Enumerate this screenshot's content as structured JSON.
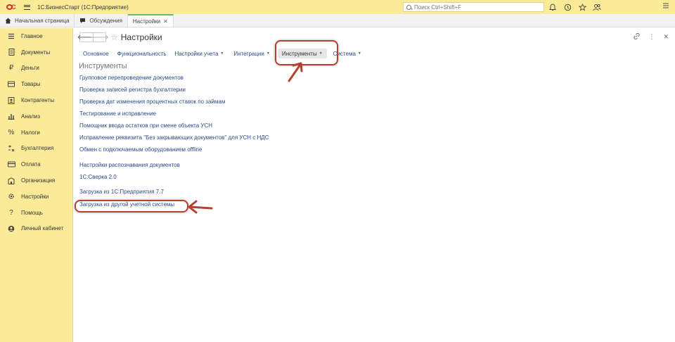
{
  "titlebar": {
    "app_title": "1С:БизнесСтарт  (1С:Предприятие)",
    "search_placeholder": "Поиск Ctrl+Shift+F"
  },
  "tabs": [
    {
      "label": "Начальная страница",
      "icon": "home-icon"
    },
    {
      "label": "Обсуждения",
      "icon": "chat-icon"
    },
    {
      "label": "Настройки",
      "icon": "none",
      "active": true
    }
  ],
  "sidebar": {
    "items": [
      {
        "label": "Главное",
        "icon": "menu-icon"
      },
      {
        "label": "Документы",
        "icon": "document-icon"
      },
      {
        "label": "Деньги",
        "icon": "ruble-icon"
      },
      {
        "label": "Товары",
        "icon": "box-icon"
      },
      {
        "label": "Контрагенты",
        "icon": "contacts-icon"
      },
      {
        "label": "Анализ",
        "icon": "bar-chart-icon"
      },
      {
        "label": "Налоги",
        "icon": "percent-icon"
      },
      {
        "label": "Бухгалтерия",
        "icon": "accounting-icon"
      },
      {
        "label": "Оплата",
        "icon": "card-icon"
      },
      {
        "label": "Организация",
        "icon": "building-icon"
      },
      {
        "label": "Настройки",
        "icon": "gear-icon"
      },
      {
        "label": "Помощь",
        "icon": "question-icon"
      },
      {
        "label": "Личный кабинет",
        "icon": "user-circle-icon"
      }
    ]
  },
  "main": {
    "page_title": "Настройки",
    "subtabs": [
      {
        "label": "Основное",
        "has_menu": false
      },
      {
        "label": "Функциональность",
        "has_menu": false
      },
      {
        "label": "Настройки учета",
        "has_menu": true
      },
      {
        "label": "Интеграции",
        "has_menu": true
      },
      {
        "label": "Инструменты",
        "has_menu": true,
        "active": true
      },
      {
        "label": "Система",
        "has_menu": true
      }
    ],
    "section_title": "Инструменты",
    "links": [
      "Групповое перепроведение документов",
      "Проверка записей регистра бухгалтерии",
      "Проверка дат изменения процентных ставок по займам",
      "Тестирование и исправление",
      "Помощник ввода остатков при смене объекта УСН",
      "Исправление реквизита \"Без закрывающих документов\" для УСН с НДС",
      "Обмен с подключаемым оборудованием offline",
      "Настройки распознавания документов",
      "1С:Сверка 2.0",
      "Загрузка из 1С:Предприятия 7.7",
      "Загрузка из другой учетной системы"
    ]
  },
  "colors": {
    "accent_yellow": "#fbeb99",
    "link_blue": "#2b4a88",
    "annotation_red": "#b5412f"
  }
}
